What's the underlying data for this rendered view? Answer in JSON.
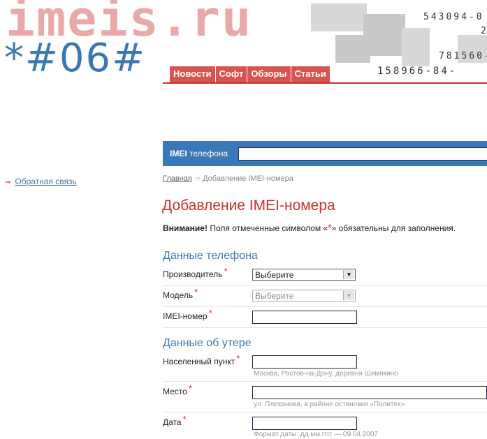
{
  "logo": {
    "site": "imeis.ru",
    "code": "*#06#"
  },
  "decor_numbers": [
    "543094-0",
    "2",
    "781560-",
    "158966-84-"
  ],
  "nav": [
    "Новости",
    "Софт",
    "Обзоры",
    "Статьи"
  ],
  "search": {
    "label_bold": "IMEI",
    "label_rest": " телефона",
    "value": ""
  },
  "sidebar": {
    "arrow": "⇒",
    "feedback": "Обратная связь"
  },
  "breadcrumb": {
    "home": "Главная",
    "sep": "⇒",
    "current": "Добавление IMEI-номера"
  },
  "page": {
    "title": "Добавление IMEI-номера",
    "notice_bold": "Внимание!",
    "notice_pre": " Поля отмеченные символом «",
    "notice_star": "*",
    "notice_post": "» обязательны для заполнения."
  },
  "phone_section": {
    "title": "Данные телефона",
    "manufacturer_label": "Производитель",
    "manufacturer_value": "Выберите",
    "model_label": "Модель",
    "model_value": "Выберите",
    "imei_label": "IMEI-номер"
  },
  "loss_section": {
    "title": "Данные об утере",
    "city_label": "Населенный пункт",
    "city_hint": "Москва, Ростов-на-Дону, деревня Шимякино",
    "place_label": "Место",
    "place_hint": "ул. Плеханова, в районе остановки «Политех»",
    "date_label": "Дата",
    "date_hint": "Формат даты: дд.мм.гггг — 09.04.2007"
  },
  "required_mark": "*",
  "colors": {
    "accent_red": "#c8312f",
    "accent_blue": "#3b78b8",
    "nav_red": "#d9534f"
  }
}
